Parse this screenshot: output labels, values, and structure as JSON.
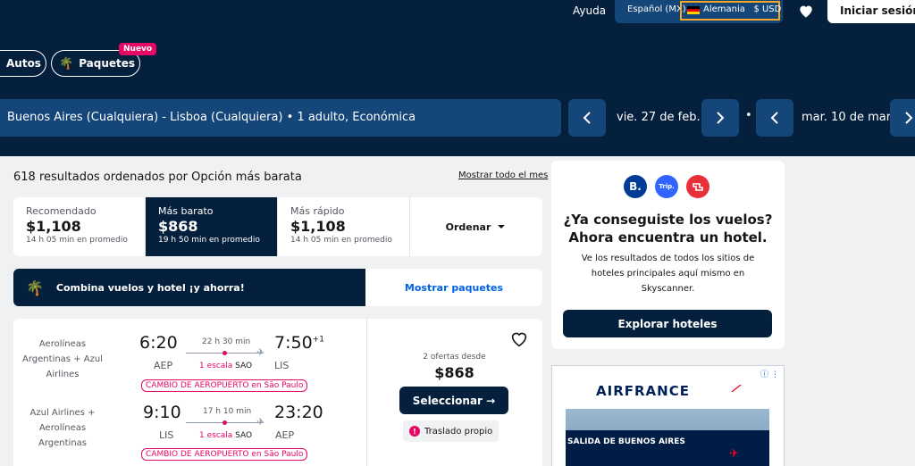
{
  "header": {
    "help": "Ayuda",
    "language": "Español (MX)",
    "region": "Alemania",
    "currency": "$ USD",
    "login": "Iniciar sesión"
  },
  "chips": {
    "autos": "Autos",
    "paquetes": "Paquetes",
    "new_badge": "Nuevo"
  },
  "search": {
    "route": "Buenos Aires (Cualquiera) - Lisboa (Cualquiera)  •  1 adulto, Económica",
    "depart_date": "vie. 27 de feb.",
    "return_date": "mar. 10 de mar.",
    "separator": "•"
  },
  "results": {
    "count_text": "618 resultados ordenados por Opción más barata",
    "show_all": "Mostrar todo el mes"
  },
  "tabs": [
    {
      "label": "Recomendado",
      "price": "$1,108",
      "sub": "14 h 05 min en promedio"
    },
    {
      "label": "Más barato",
      "price": "$868",
      "sub": "19 h 50 min en promedio"
    },
    {
      "label": "Más rápido",
      "price": "$1,108",
      "sub": "14 h 05 min en promedio"
    }
  ],
  "sort_label": "Ordenar",
  "promo": {
    "text": "Combina vuelos y hotel ¡y ahorra!",
    "cta": "Mostrar paquetes"
  },
  "flight": {
    "outbound": {
      "airline": "Aerolíneas Argentinas + Azul Airlines",
      "dep_time": "6:20",
      "arr_time": "7:50",
      "arr_plus": "+1",
      "dep_code": "AEP",
      "arr_code": "LIS",
      "duration": "22 h 30 min",
      "stops": "1 escala",
      "stop_code": "SAO",
      "warning": "CAMBIO DE AEROPUERTO en São Paulo"
    },
    "inbound": {
      "airline": "Azul Airlines + Aerolíneas Argentinas",
      "dep_time": "9:10",
      "arr_time": "23:20",
      "dep_code": "LIS",
      "arr_code": "AEP",
      "duration": "17 h 10 min",
      "stops": "1 escala",
      "stop_code": "SAO",
      "warning": "CAMBIO DE AEROPUERTO en São Paulo"
    },
    "offers": "2 ofertas desde",
    "price": "$868",
    "select": "Seleccionar →",
    "self_transfer": "Traslado propio"
  },
  "hotel_card": {
    "logos": [
      "B.",
      "Trip.",
      ""
    ],
    "title": "¿Ya conseguiste los vuelos? Ahora encuentra un hotel.",
    "desc": "Ve los resultados de todos los sitios de hoteles principales aquí mismo en Skyscanner.",
    "cta": "Explorar hoteles"
  },
  "ad": {
    "brand": "AIRFRANCE",
    "text": "SALIDA DE BUENOS AIRES"
  },
  "colors": {
    "navy": "#05203c",
    "blue_mid": "#154679",
    "accent_pink": "#e70866",
    "link_blue": "#0062e3"
  }
}
